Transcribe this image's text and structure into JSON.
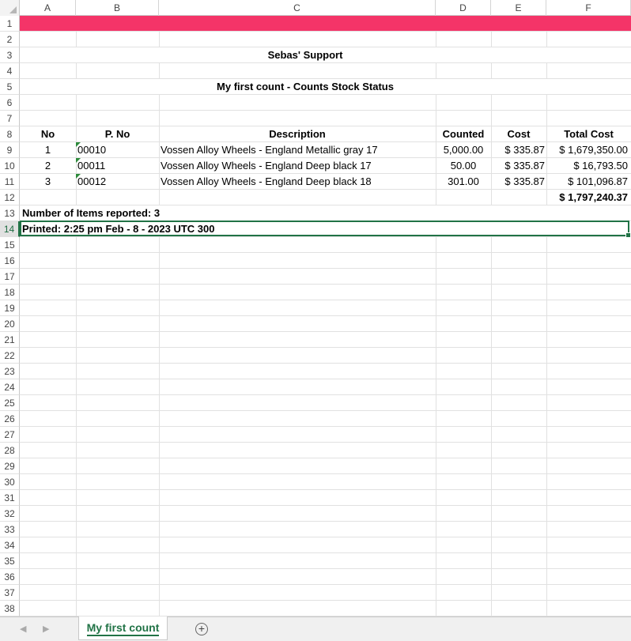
{
  "columns": [
    "A",
    "B",
    "C",
    "D",
    "E",
    "F"
  ],
  "rows": [
    "1",
    "2",
    "3",
    "4",
    "5",
    "6",
    "7",
    "8",
    "9",
    "10",
    "11",
    "12",
    "13",
    "14",
    "15",
    "16",
    "17",
    "18",
    "19",
    "20",
    "21",
    "22",
    "23",
    "24",
    "25",
    "26",
    "27",
    "28",
    "29",
    "30",
    "31",
    "32",
    "33",
    "34",
    "35",
    "36",
    "37",
    "38"
  ],
  "title": "Sebas' Support",
  "subtitle": "My first count  - Counts Stock Status",
  "headers": {
    "no": "No",
    "pno": "P. No",
    "description": "Description",
    "counted": "Counted",
    "cost": "Cost",
    "total_cost": "Total Cost"
  },
  "items": [
    {
      "no": "1",
      "pno": "00010",
      "description": "Vossen Alloy Wheels - England Metallic gray 17",
      "counted": "5,000.00",
      "cost": "$ 335.87",
      "total": "$ 1,679,350.00"
    },
    {
      "no": "2",
      "pno": "00011",
      "description": "Vossen Alloy Wheels - England Deep black 17",
      "counted": "50.00",
      "cost": "$ 335.87",
      "total": "$ 16,793.50"
    },
    {
      "no": "3",
      "pno": "00012",
      "description": "Vossen Alloy Wheels - England Deep black 18",
      "counted": "301.00",
      "cost": "$ 335.87",
      "total": "$ 101,096.87"
    }
  ],
  "grand_total": "$ 1,797,240.37",
  "items_reported": "Number of Items reported: 3",
  "printed": "Printed: 2:25 pm Feb - 8 - 2023 UTC 300",
  "sheet_tab": "My first count",
  "add_sheet_icon": "plus-circle-icon",
  "colors": {
    "banner": "#f43468",
    "accent": "#217346"
  }
}
